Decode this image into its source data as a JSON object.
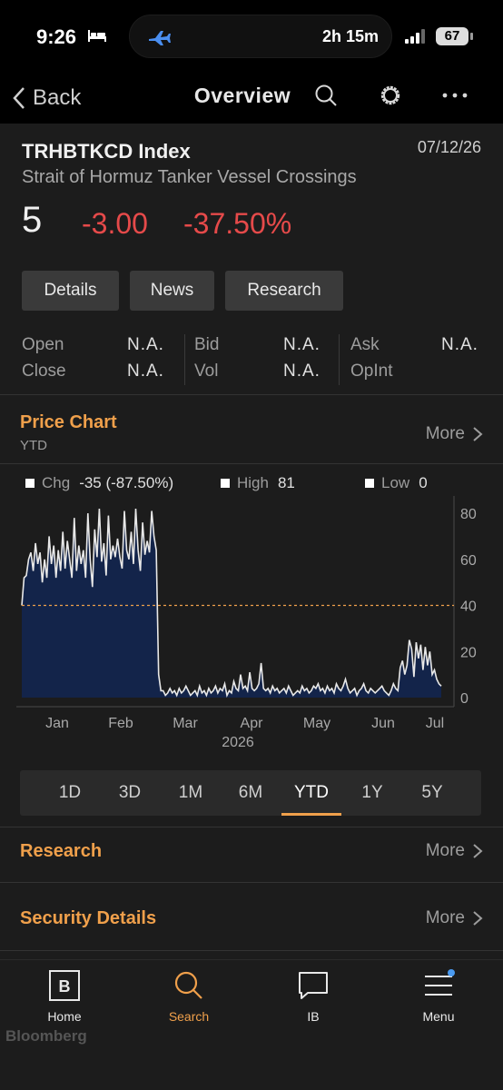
{
  "status": {
    "time": "9:26",
    "activity": "2h 15m",
    "battery": "67"
  },
  "nav": {
    "back_label": "Back",
    "title": "Overview"
  },
  "security": {
    "ticker": "TRHBTKCD Index",
    "date": "07/12/26",
    "name": "Strait of Hormuz Tanker Vessel Crossings",
    "last": "5",
    "change": "-3.00",
    "pct_change": "-37.50%"
  },
  "buttons": [
    "Details",
    "News",
    "Research"
  ],
  "quote": {
    "open_label": "Open",
    "open_value": "N.A.",
    "close_label": "Close",
    "close_value": "N.A.",
    "bid_label": "Bid",
    "bid_value": "N.A.",
    "vol_label": "Vol",
    "vol_value": "N.A.",
    "ask_label": "Ask",
    "ask_value": "N.A.",
    "opint_label": "OpInt",
    "opint_value": "N.A."
  },
  "price_chart": {
    "title": "Price Chart",
    "period": "YTD",
    "more": "More",
    "legend": {
      "chg_label": "Chg",
      "chg_value": "-35 (-87.50%)",
      "high_label": "High",
      "high_value": "81",
      "low_label": "Low",
      "low_value": "0"
    }
  },
  "chart_data": {
    "type": "area",
    "x_tick_labels": [
      "Jan",
      "Feb",
      "Mar",
      "Apr",
      "May",
      "Jun",
      "Jul"
    ],
    "x_year_label": "2026",
    "y_tick_labels": [
      "80",
      "60",
      "40",
      "20",
      "0"
    ],
    "ylim": [
      0,
      82
    ],
    "reference_line": 40,
    "colors": {
      "line": "#e8e8e8",
      "fill": "#13244a",
      "reference": "#f0a04b"
    },
    "series": [
      {
        "values": [
          40,
          52,
          53,
          60,
          63,
          55,
          67,
          58,
          63,
          50,
          60,
          52,
          70,
          58,
          66,
          52,
          64,
          55,
          72,
          56,
          68,
          60,
          52,
          78,
          55,
          66,
          58,
          64,
          52,
          80,
          60,
          48,
          73,
          61,
          82,
          59,
          67,
          53,
          79,
          60,
          66,
          61,
          69,
          61,
          56,
          81,
          64,
          60,
          72,
          58,
          82,
          64,
          55,
          76,
          62,
          68,
          63,
          81,
          70,
          64,
          10,
          3,
          3,
          1,
          2,
          4,
          2,
          3,
          1,
          4,
          2,
          3,
          5,
          3,
          1,
          2,
          3,
          1,
          5,
          2,
          3,
          1,
          4,
          2,
          3,
          5,
          2,
          4,
          3,
          6,
          1,
          3,
          2,
          7,
          4,
          3,
          10,
          4,
          5,
          3,
          11,
          4,
          3,
          4,
          6,
          15,
          4,
          3,
          4,
          2,
          5,
          3,
          4,
          2,
          3,
          4,
          2,
          5,
          3,
          1,
          2,
          3,
          2,
          5,
          3,
          4,
          2,
          3,
          5,
          4,
          6,
          3,
          4,
          2,
          5,
          3,
          4,
          2,
          6,
          4,
          3,
          5,
          8,
          4,
          2,
          3,
          4,
          1,
          3,
          4,
          6,
          3,
          2,
          4,
          3,
          2,
          3,
          4,
          5,
          3,
          2,
          1,
          3,
          6,
          4,
          3,
          13,
          16,
          10,
          14,
          25,
          21,
          9,
          24,
          17,
          23,
          12,
          22,
          14,
          20,
          10,
          12,
          8,
          6,
          5
        ]
      }
    ]
  },
  "range_buttons": [
    "1D",
    "3D",
    "1M",
    "6M",
    "YTD",
    "1Y",
    "5Y"
  ],
  "sections": {
    "research_title": "Research",
    "research_more": "More",
    "details_title": "Security Details",
    "details_more": "More"
  },
  "tabs": [
    "Home",
    "Search",
    "IB",
    "Menu"
  ],
  "brand": "Bloomberg"
}
